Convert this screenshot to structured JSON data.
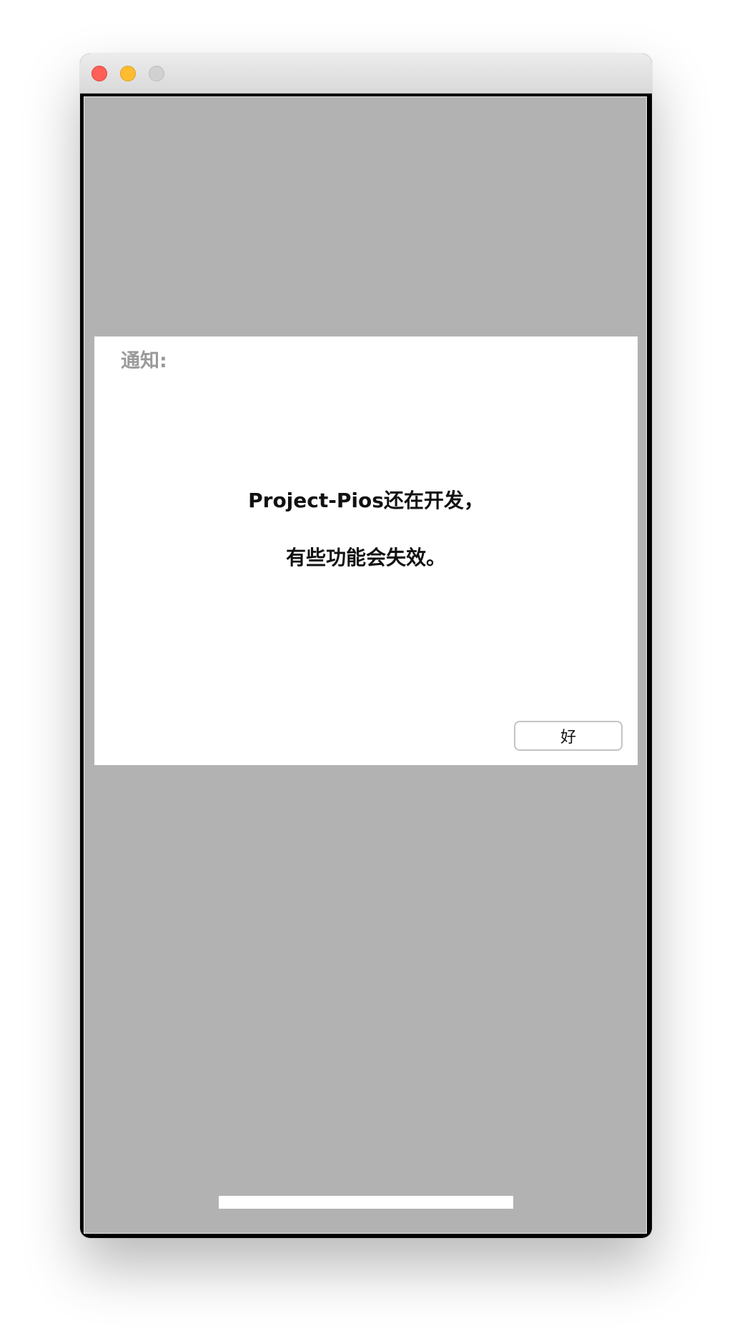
{
  "dialog": {
    "title": "通知:",
    "message_line1": "Project-Pios还在开发，",
    "message_line2": "有些功能会失效。",
    "ok_label": "好"
  },
  "colors": {
    "backdrop": "#b2b2b2",
    "dialog_bg": "#ffffff",
    "title_text": "#9a9a9a",
    "body_text": "#111111",
    "close_button": "#fe5f57",
    "minimize_button": "#febc2e",
    "zoom_button": "#d1d1d1"
  },
  "icons": {
    "close": "close-traffic-light-icon",
    "minimize": "minimize-traffic-light-icon",
    "zoom": "zoom-traffic-light-icon"
  }
}
